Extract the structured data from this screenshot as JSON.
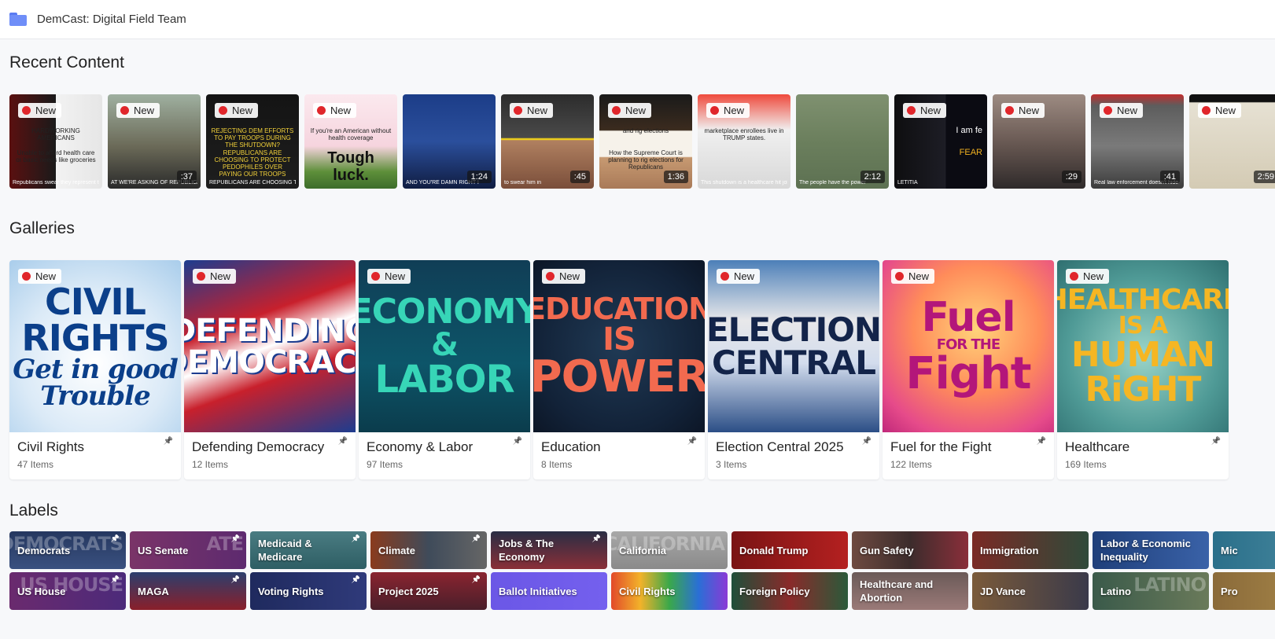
{
  "header": {
    "title": "DemCast: Digital Field Team"
  },
  "sections": {
    "recent": "Recent Content",
    "galleries": "Galleries",
    "labels": "Labels"
  },
  "new_badge": "New",
  "recent": [
    {
      "new": true,
      "duration": "",
      "bg": "linear-gradient(90deg,#5a1010 0%,#1a1a1a 50%,#f2f2f2 50%,#e6e6e6 100%)",
      "caption": "Republicans swear they represent the working class",
      "lines": [
        "HARDWORKING AMERICANS",
        "Unable to afford health care or basic needs like groceries"
      ]
    },
    {
      "new": true,
      "duration": ":37",
      "bg": "linear-gradient(180deg,#9fb0a0 0%,#6b6a58 55%,#2a2a2a 100%)",
      "caption": "AT WE'RE ASKING OF REPUBLICANS RIGHT N"
    },
    {
      "new": true,
      "duration": "",
      "bg": "linear-gradient(180deg,#141414 0%,#1e1e1e 100%)",
      "caption": "REPUBLICANS ARE CHOOSING TO PROTECT PEDOPHILES",
      "lines": [
        "REJECTING DEM EFFORTS TO PAY TROOPS DURING THE SHUTDOWN?",
        "REPUBLICANS ARE CHOOSING TO PROTECT PEDOPHILES OVER PAYING OUR TROOPS"
      ]
    },
    {
      "new": true,
      "duration": "",
      "bg": "linear-gradient(180deg,#fbe9ee 0%,#f6d4de 55%,#5e8f3a 82%,#3d6d2a 100%)",
      "caption": "",
      "lines": [
        "If you're an American without health coverage",
        "Tough luck."
      ]
    },
    {
      "new": false,
      "duration": "1:24",
      "bg": "linear-gradient(180deg,#1c3d88 0%,#2b4f9c 50%,#101d42 100%)",
      "caption": "AND YOU'RE DAMN RIGHT I"
    },
    {
      "new": true,
      "duration": ":45",
      "bg": "linear-gradient(180deg,#2c2c2c 0%,#4a4a4a 46%,#f1d21a 47%,#f1d21a 48%,#b08060 49%,#7a4e3a 100%)",
      "caption": "to swear him in"
    },
    {
      "new": true,
      "duration": "1:36",
      "bg": "linear-gradient(180deg,#1a1a1a 0%,#3b2b1e 38%,#f6f2ea 39%,#f6f2ea 66%,#c79a72 67%,#a97a58 100%)",
      "caption": "",
      "lines": [
        "and rig elections",
        "How the Supreme Court is planning to rig elections for Republicans"
      ]
    },
    {
      "new": true,
      "duration": "",
      "bg": "linear-gradient(180deg,#ef4a3c 0%,#f0f0f0 38%,#d8d8d8 100%)",
      "caption": "This shutdown is a healthcare hit job on",
      "lines": [
        "marketplace enrollees live in TRUMP states."
      ]
    },
    {
      "new": false,
      "duration": "2:12",
      "bg": "linear-gradient(180deg,#7f9170 0%,#6b7f5d 50%,#5d7152 100%)",
      "caption": "The people have the power"
    },
    {
      "new": true,
      "duration": "",
      "bg": "linear-gradient(90deg,#0e0e10 0%,#1d1d25 55%,#0b0b12 56%,#0b0b12 100%)",
      "caption": "LETITIA",
      "lines": [
        "I am fe",
        "FEAR"
      ]
    },
    {
      "new": true,
      "duration": ":29",
      "bg": "linear-gradient(180deg,#9d8b82 0%,#6a5a54 50%,#2f2a2a 100%)",
      "caption": ""
    },
    {
      "new": true,
      "duration": ":41",
      "bg": "linear-gradient(180deg,#c22e2e 0%,#5d5d5d 12%,#7a7a7a 55%,#3c3c3c 100%)",
      "caption": "Real law enforcement doesn't hide"
    },
    {
      "new": true,
      "duration": "2:59",
      "bg": "linear-gradient(180deg,#111 0%,#111 8%,#e6e1d3 9%,#d4cbb4 100%)",
      "caption": ""
    }
  ],
  "galleries": [
    {
      "name": "Civil Rights",
      "count": "47 Items",
      "art": [
        "CIVIL",
        "RIGHTS",
        "Get in good Trouble"
      ],
      "bg": "radial-gradient(circle at 50% 60%,#ffffff 0%,#dbeaf7 55%,#a9cdeb 100%)",
      "fg": "#0b3f8a"
    },
    {
      "name": "Defending Democracy",
      "count": "12 Items",
      "art": [
        "DEFENDING",
        "DEMOCRACY"
      ],
      "bg": "linear-gradient(160deg,#1d3c8f 0%,#c8202c 35%,#ffffff 50%,#c8202c 65%,#1d3c8f 100%)",
      "fg": "#ffffff"
    },
    {
      "name": "Economy & Labor",
      "count": "97 Items",
      "art": [
        "ECONOMY",
        "&",
        "LABOR"
      ],
      "bg": "linear-gradient(180deg,#103e56 0%,#0d5569 60%,#0b3c4c 100%)",
      "fg": "#37d5b7"
    },
    {
      "name": "Education",
      "count": "8 Items",
      "art": [
        "EDUCATION",
        "IS",
        "POWER"
      ],
      "bg": "radial-gradient(circle at 50% 50%,#203a55 0%,#122238 70%,#0c1626 100%)",
      "fg": "#f26a4f"
    },
    {
      "name": "Election Central 2025",
      "count": "3 Items",
      "art": [
        "ELECTION",
        "CENTRAL"
      ],
      "bg": "linear-gradient(180deg,#4c7fb8 0%,#e8e8ea 35%,#d2dced 60%,#2b4e86 100%)",
      "fg": "#13244a"
    },
    {
      "name": "Fuel for the Fight",
      "count": "122 Items",
      "art": [
        "Fuel",
        "FOR THE",
        "Fight"
      ],
      "bg": "radial-gradient(circle at 55% 40%,#ffd37a 0%,#ff8c5a 45%,#e64b8a 80%,#c0287a 100%)",
      "fg": "#b3167a"
    },
    {
      "name": "Healthcare",
      "count": "169 Items",
      "art": [
        "HEALTHCARE",
        "IS A",
        "HUMAN",
        "RiGHT"
      ],
      "bg": "radial-gradient(circle at 50% 55%,#9ad4c8 0%,#4f9a96 60%,#2f6f70 100%)",
      "fg": "#f5b623"
    }
  ],
  "labels": [
    {
      "label": "Democrats",
      "pin": true,
      "bg": "linear-gradient(180deg,#25375f 0%,#3a5180 100%)",
      "wm": "DEMOCRATS"
    },
    {
      "label": "US Senate",
      "pin": true,
      "bg": "linear-gradient(90deg,#7a3468 0%,#5d2a6f 100%)",
      "wm": "ATE"
    },
    {
      "label": "Medicaid & Medicare",
      "pin": true,
      "bg": "linear-gradient(180deg,#4a7c82 0%,#2e5e64 100%)",
      "wm": ""
    },
    {
      "label": "Climate",
      "pin": true,
      "bg": "linear-gradient(90deg,#8a3b1d 0%,#3f4b5a 50%,#666 100%)",
      "wm": ""
    },
    {
      "label": "Jobs & The Economy",
      "pin": true,
      "bg": "linear-gradient(180deg,#2a2e44 0%,#8a2f38 100%)",
      "wm": ""
    },
    {
      "label": "California",
      "pin": false,
      "bg": "linear-gradient(180deg,#a8a8a8 0%,#8a8a8a 100%)",
      "wm": "CALIFORNIA"
    },
    {
      "label": "Donald Trump",
      "pin": false,
      "bg": "linear-gradient(90deg,#7a1414 0%,#b42020 100%)",
      "wm": ""
    },
    {
      "label": "Gun Safety",
      "pin": false,
      "bg": "linear-gradient(90deg,#6e4a40 0%,#3c2c2c 50%,#8a2f3a 100%)",
      "wm": ""
    },
    {
      "label": "Immigration",
      "pin": false,
      "bg": "linear-gradient(90deg,#7a2a25 0%,#2f4a3a 100%)",
      "wm": ""
    },
    {
      "label": "Labor & Economic Inequality",
      "pin": false,
      "bg": "linear-gradient(90deg,#1f3f7a 0%,#3a62a8 100%)",
      "wm": ""
    },
    {
      "label": "Mic",
      "pin": false,
      "bg": "linear-gradient(90deg,#2a6f8a 0%,#4a8aa0 100%)",
      "wm": ""
    },
    {
      "label": "US House",
      "pin": true,
      "bg": "linear-gradient(90deg,#6a2a6e 0%,#4c2a7a 100%)",
      "wm": "US HOUSE"
    },
    {
      "label": "MAGA",
      "pin": true,
      "bg": "linear-gradient(180deg,#2c3f6e 0%,#8a1f2a 100%)",
      "wm": ""
    },
    {
      "label": "Voting Rights",
      "pin": true,
      "bg": "linear-gradient(90deg,#1f2a5e 0%,#2f3a7a 100%)",
      "wm": ""
    },
    {
      "label": "Project 2025",
      "pin": true,
      "bg": "linear-gradient(180deg,#8a2430 0%,#4a1f2a 100%)",
      "wm": ""
    },
    {
      "label": "Ballot Initiatives",
      "pin": false,
      "bg": "linear-gradient(90deg,#6b57e6 0%,#7460ee 100%)",
      "wm": ""
    },
    {
      "label": "Civil Rights",
      "pin": false,
      "bg": "linear-gradient(90deg,#e24a2a 0%,#f2b22a 25%,#3aa84a 50%,#2a6fd6 75%,#8a3ad6 100%)",
      "wm": ""
    },
    {
      "label": "Foreign Policy",
      "pin": false,
      "bg": "linear-gradient(90deg,#1f4f3a 0%,#8a2a2a 50%,#2a5a3a 100%)",
      "wm": ""
    },
    {
      "label": "Healthcare and Abortion",
      "pin": false,
      "bg": "linear-gradient(180deg,#6a5a58 0%,#9a7a78 100%)",
      "wm": ""
    },
    {
      "label": "JD Vance",
      "pin": false,
      "bg": "linear-gradient(90deg,#7a5a3a 0%,#3a3a4a 100%)",
      "wm": ""
    },
    {
      "label": "Latino",
      "pin": false,
      "bg": "linear-gradient(90deg,#3a5a4a 0%,#6a7a5a 100%)",
      "wm": "LATINO"
    },
    {
      "label": "Pro",
      "pin": false,
      "bg": "linear-gradient(90deg,#8a6a3a 0%,#aa8a4a 100%)",
      "wm": ""
    }
  ]
}
